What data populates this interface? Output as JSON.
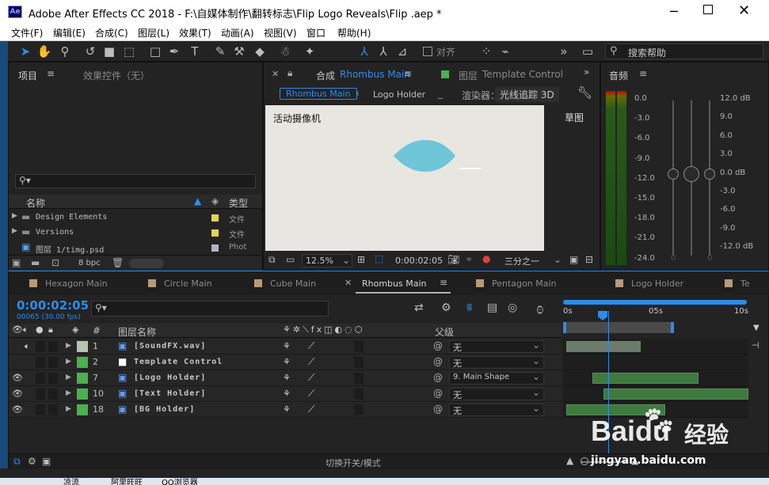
{
  "window": {
    "title": "Adobe After Effects CC 2018 - F:\\自媒体制作\\翻转标志\\Flip Logo Reveals\\Flip .aep *",
    "app_badge": "Ae"
  },
  "menu": [
    "文件(F)",
    "编辑(E)",
    "合成(C)",
    "图层(L)",
    "效果(T)",
    "动画(A)",
    "视图(V)",
    "窗口",
    "帮助(H)"
  ],
  "toolbar": {
    "snap_label": "对齐",
    "search_placeholder": "搜索帮助"
  },
  "project_panel": {
    "tab_project": "项目",
    "tab_effects": "效果控件（无）",
    "col_name": "名称",
    "col_type": "类型",
    "items": [
      {
        "name": "Design Elements",
        "type": "文件",
        "color": "#e6d44a",
        "kind": "folder"
      },
      {
        "name": "Versions",
        "type": "文件",
        "color": "#e6d44a",
        "kind": "folder"
      },
      {
        "name": "图层 1/timg.psd",
        "type": "Phot",
        "color": "#b8b0c8",
        "kind": "psd"
      }
    ],
    "bpc": "8 bpc"
  },
  "comp_panel": {
    "tab_prefix": "合成",
    "tab_name": "Rhombus Main",
    "layer_tab_prefix": "图层",
    "layer_tab_name": "Template Control",
    "breadcrumb_active": "Rhombus Main",
    "breadcrumb_next": "Logo Holder",
    "renderer_label": "渲染器：",
    "renderer_value": "光线追踪 3D",
    "camera_label": "活动摄像机",
    "draft_label": "草图",
    "zoom": "12.5%",
    "timecode": "0:00:02:05",
    "resolution": "三分之一"
  },
  "audio_panel": {
    "title": "音频",
    "left_scale": [
      "0.0",
      "-3.0",
      "-6.0",
      "-9.0",
      "-12.0",
      "-15.0",
      "-18.0",
      "-21.0",
      "-24.0"
    ],
    "right_scale": [
      "12.0 dB",
      "9.0",
      "6.0",
      "3.0",
      "0.0 dB",
      "-3.0",
      "-6.0",
      "-9.0",
      "-12.0 dB"
    ],
    "zero_labels": [
      "0",
      "0"
    ]
  },
  "timeline": {
    "tabs": [
      {
        "name": "Hexagon Main",
        "active": false
      },
      {
        "name": "Circle Main",
        "active": false
      },
      {
        "name": "Cube Main",
        "active": false
      },
      {
        "name": "Rhombus Main",
        "active": true
      },
      {
        "name": "Pentagon Main",
        "active": false
      },
      {
        "name": "Logo Holder",
        "active": false
      },
      {
        "name": "Te",
        "active": false
      }
    ],
    "timecode": "0:00:02:05",
    "frame_info": "00065 (30.00 fps)",
    "col_num": "#",
    "col_layer_name": "图层名称",
    "col_parent": "父级",
    "ruler_labels": [
      "0s",
      "05s",
      "10s"
    ],
    "playhead_fraction": 0.2,
    "layers": [
      {
        "num": "1",
        "name": "[SoundFX.wav]",
        "parent": "无",
        "color": "#b8c4b0",
        "bar_start": 0.0,
        "bar_end": 0.42,
        "bar_color": "#6b7c6b"
      },
      {
        "num": "2",
        "name": "Template Control",
        "parent": "无",
        "color": "#4caf50",
        "bar_start": 0.0,
        "bar_end": 0.0,
        "bar_color": "#3e7a3e"
      },
      {
        "num": "7",
        "name": "[Logo Holder]",
        "parent": "9. Main Shape",
        "color": "#4caf50",
        "bar_start": 0.14,
        "bar_end": 0.73,
        "bar_color": "#3e7a3e"
      },
      {
        "num": "10",
        "name": "[Text Holder]",
        "parent": "无",
        "color": "#4caf50",
        "bar_start": 0.2,
        "bar_end": 1.0,
        "bar_color": "#3e7a3e"
      },
      {
        "num": "18",
        "name": "[BG Holder]",
        "parent": "无",
        "color": "#4caf50",
        "bar_start": 0.0,
        "bar_end": 0.55,
        "bar_color": "#3e7a3e"
      }
    ],
    "footer": "切换开关/模式"
  },
  "watermark": {
    "brand": "Baidu",
    "cn": "经验",
    "url": "jingyan.baidu.com"
  },
  "taskbar": [
    "凉流",
    "阿里旺旺",
    "QQ浏览器"
  ],
  "colors": {
    "accent": "#2d8ceb",
    "teal_shape": "#6ec6d8",
    "comp_bg": "#e8e6e1"
  }
}
